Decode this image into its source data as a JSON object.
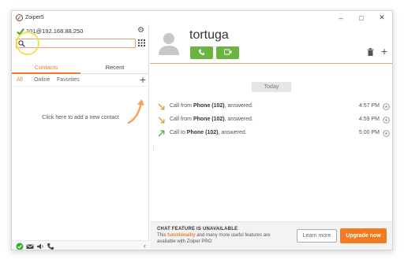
{
  "window": {
    "title": "Zoiper5",
    "minimize": "–",
    "maximize": "□",
    "close": "✕"
  },
  "account": {
    "label": "101@192.168.88.250",
    "status": "registered"
  },
  "search": {
    "value": "",
    "placeholder": ""
  },
  "tabs": [
    {
      "label": "Contacts",
      "active": true
    },
    {
      "label": "Recent",
      "active": false
    }
  ],
  "filters": [
    {
      "label": "All",
      "active": true
    },
    {
      "label": "Online",
      "active": false
    },
    {
      "label": "Favorites",
      "active": false
    }
  ],
  "contacts": {
    "empty_hint": "Click here to add a new contact"
  },
  "contact": {
    "name": "tortuga"
  },
  "history": {
    "date": "Today",
    "calls": [
      {
        "direction": "incoming",
        "prefix": "Call from ",
        "target": "Phone (102)",
        "suffix": ", answered.",
        "time": "4:57 PM"
      },
      {
        "direction": "incoming",
        "prefix": "Call from ",
        "target": "Phone (102)",
        "suffix": ", answered.",
        "time": "4:59 PM"
      },
      {
        "direction": "outgoing",
        "prefix": "Call to ",
        "target": "Phone (102)",
        "suffix": ", answered.",
        "time": "5:00 PM"
      }
    ]
  },
  "chat_banner": {
    "title": "CHAT FEATURE IS UNAVAILABLE",
    "desc_before": "This ",
    "desc_highlight": "functionality",
    "desc_after": " and many more useful features are available with Zoiper PRO",
    "learn_more": "Learn more",
    "upgrade": "Upgrade now"
  },
  "colors": {
    "accent": "#f07b30",
    "green": "#6cb33f",
    "highlight": "#f2e24a"
  }
}
